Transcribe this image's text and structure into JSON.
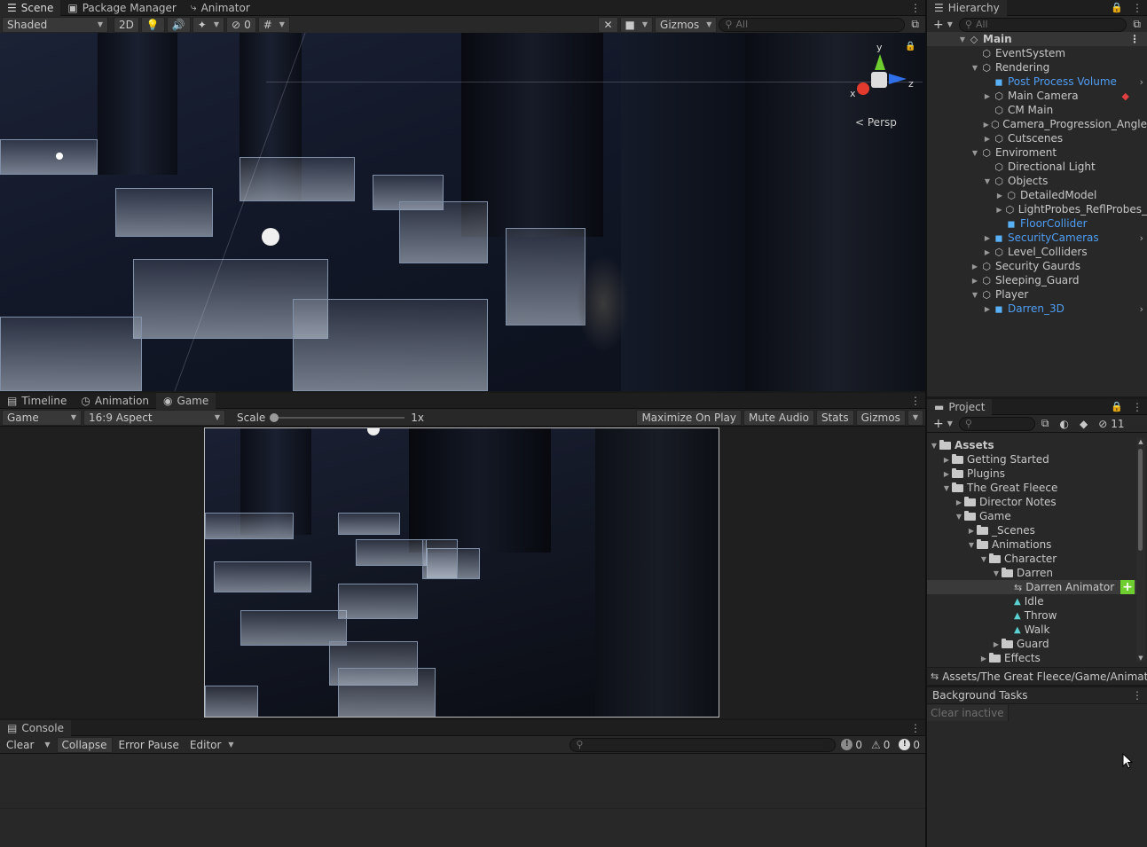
{
  "scene_panel": {
    "tabs": [
      {
        "label": "Scene",
        "active": true
      },
      {
        "label": "Package Manager",
        "active": false
      },
      {
        "label": "Animator",
        "active": false
      }
    ],
    "shading_mode": "Shaded",
    "mode_2d": "2D",
    "hidden_count": "0",
    "gizmos_label": "Gizmos",
    "search_placeholder": "All",
    "projection_label": "Persp",
    "axis_labels": {
      "x": "x",
      "y": "y",
      "z": "z"
    }
  },
  "game_panel": {
    "tabs": [
      {
        "label": "Timeline",
        "active": false
      },
      {
        "label": "Animation",
        "active": false
      },
      {
        "label": "Game",
        "active": true
      }
    ],
    "display": "Game",
    "aspect": "16:9 Aspect",
    "scale_label": "Scale",
    "scale_value": "1x",
    "maximize_label": "Maximize On Play",
    "mute_label": "Mute Audio",
    "stats_label": "Stats",
    "gizmos_label": "Gizmos"
  },
  "console_panel": {
    "tab_label": "Console",
    "clear_label": "Clear",
    "collapse_label": "Collapse",
    "error_pause_label": "Error Pause",
    "editor_label": "Editor",
    "info_count": "0",
    "warning_count": "0",
    "error_count": "0"
  },
  "hierarchy": {
    "tab_label": "Hierarchy",
    "search_placeholder": "All",
    "root": "Main",
    "items": [
      {
        "label": "EventSystem",
        "depth": 1,
        "arrow": "",
        "prefab": false
      },
      {
        "label": "Rendering",
        "depth": 1,
        "arrow": "down",
        "prefab": false
      },
      {
        "label": "Post Process Volume",
        "depth": 2,
        "arrow": "",
        "prefab": true,
        "chevron": true
      },
      {
        "label": "Main Camera",
        "depth": 2,
        "arrow": "right",
        "prefab": false,
        "badge": true
      },
      {
        "label": "CM Main",
        "depth": 2,
        "arrow": "",
        "prefab": false
      },
      {
        "label": "Camera_Progression_Angle",
        "depth": 2,
        "arrow": "right",
        "prefab": false
      },
      {
        "label": "Cutscenes",
        "depth": 2,
        "arrow": "right",
        "prefab": false
      },
      {
        "label": "Enviroment",
        "depth": 1,
        "arrow": "down",
        "prefab": false
      },
      {
        "label": "Directional Light",
        "depth": 2,
        "arrow": "",
        "prefab": false
      },
      {
        "label": "Objects",
        "depth": 2,
        "arrow": "down",
        "prefab": false
      },
      {
        "label": "DetailedModel",
        "depth": 3,
        "arrow": "right",
        "prefab": false
      },
      {
        "label": "LightProbes_ReflProbes_",
        "depth": 3,
        "arrow": "right",
        "prefab": false
      },
      {
        "label": "FloorCollider",
        "depth": 3,
        "arrow": "",
        "prefab": true
      },
      {
        "label": "SecurityCameras",
        "depth": 2,
        "arrow": "right",
        "prefab": true,
        "chevron": true
      },
      {
        "label": "Level_Colliders",
        "depth": 2,
        "arrow": "right",
        "prefab": false
      },
      {
        "label": "Security Gaurds",
        "depth": 1,
        "arrow": "right",
        "prefab": false
      },
      {
        "label": "Sleeping_Guard",
        "depth": 1,
        "arrow": "right",
        "prefab": false
      },
      {
        "label": "Player",
        "depth": 1,
        "arrow": "down",
        "prefab": false
      },
      {
        "label": "Darren_3D",
        "depth": 2,
        "arrow": "right",
        "prefab": true,
        "chevron": true
      }
    ]
  },
  "project": {
    "tab_label": "Project",
    "hidden_count": "11",
    "root": "Assets",
    "items": [
      {
        "label": "Getting Started",
        "depth": 1,
        "arrow": "right",
        "kind": "folder"
      },
      {
        "label": "Plugins",
        "depth": 1,
        "arrow": "right",
        "kind": "folder"
      },
      {
        "label": "The Great Fleece",
        "depth": 1,
        "arrow": "down",
        "kind": "folder-open"
      },
      {
        "label": "Director Notes",
        "depth": 2,
        "arrow": "right",
        "kind": "folder"
      },
      {
        "label": "Game",
        "depth": 2,
        "arrow": "down",
        "kind": "folder-open"
      },
      {
        "label": "_Scenes",
        "depth": 3,
        "arrow": "right",
        "kind": "folder"
      },
      {
        "label": "Animations",
        "depth": 3,
        "arrow": "down",
        "kind": "folder-open"
      },
      {
        "label": "Character",
        "depth": 4,
        "arrow": "down",
        "kind": "folder-open"
      },
      {
        "label": "Darren",
        "depth": 5,
        "arrow": "down",
        "kind": "folder-open"
      },
      {
        "label": "Darren Animator",
        "depth": 6,
        "arrow": "",
        "kind": "animator",
        "selected": true
      },
      {
        "label": "Idle",
        "depth": 6,
        "arrow": "",
        "kind": "anim"
      },
      {
        "label": "Throw",
        "depth": 6,
        "arrow": "",
        "kind": "anim"
      },
      {
        "label": "Walk",
        "depth": 6,
        "arrow": "",
        "kind": "anim"
      },
      {
        "label": "Guard",
        "depth": 5,
        "arrow": "right",
        "kind": "folder"
      },
      {
        "label": "Effects",
        "depth": 4,
        "arrow": "right",
        "kind": "folder"
      }
    ],
    "path": "Assets/The Great Fleece/Game/Animati"
  },
  "background_tasks": {
    "title": "Background Tasks",
    "clear_inactive": "Clear inactive"
  },
  "colors": {
    "accent": "#4a7bd0",
    "prefab": "#4f9ef4",
    "add_badge": "#6fce2f"
  }
}
